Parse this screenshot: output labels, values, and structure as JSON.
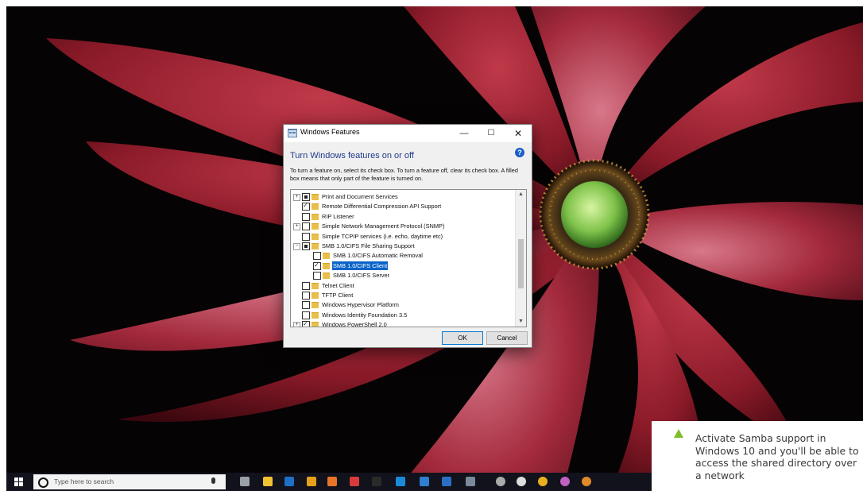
{
  "dialog": {
    "title": "Windows Features",
    "controls": {
      "minimize": "—",
      "maximize": "☐",
      "close": "✕"
    },
    "heading": "Turn Windows features on or off",
    "help_icon": "?",
    "instructions": "To turn a feature on, select its check box. To turn a feature off, clear its check box. A filled box means that only part of the feature is turned on.",
    "features": [
      {
        "label": "Print and Document Services",
        "state": "partial",
        "expandable": true,
        "indent": 0
      },
      {
        "label": "Remote Differential Compression API Support",
        "state": "checked",
        "expandable": false,
        "indent": 0
      },
      {
        "label": "RIP Listener",
        "state": "unchecked",
        "expandable": false,
        "indent": 0
      },
      {
        "label": "Simple Network Management Protocol (SNMP)",
        "state": "unchecked",
        "expandable": true,
        "indent": 0
      },
      {
        "label": "Simple TCPIP services (i.e. echo, daytime etc)",
        "state": "unchecked",
        "expandable": false,
        "indent": 0
      },
      {
        "label": "SMB 1.0/CIFS File Sharing Support",
        "state": "partial",
        "expandable": true,
        "expanded": true,
        "indent": 0
      },
      {
        "label": "SMB 1.0/CIFS Automatic Removal",
        "state": "unchecked",
        "expandable": false,
        "indent": 1
      },
      {
        "label": "SMB 1.0/CIFS Client",
        "state": "checked",
        "expandable": false,
        "indent": 1,
        "selected": true
      },
      {
        "label": "SMB 1.0/CIFS Server",
        "state": "unchecked",
        "expandable": false,
        "indent": 1
      },
      {
        "label": "Telnet Client",
        "state": "unchecked",
        "expandable": false,
        "indent": 0
      },
      {
        "label": "TFTP Client",
        "state": "unchecked",
        "expandable": false,
        "indent": 0
      },
      {
        "label": "Windows Hypervisor Platform",
        "state": "unchecked",
        "expandable": false,
        "indent": 0
      },
      {
        "label": "Windows Identity Foundation 3.5",
        "state": "unchecked",
        "expandable": false,
        "indent": 0
      },
      {
        "label": "Windows PowerShell 2.0",
        "state": "checked",
        "expandable": true,
        "indent": 0
      }
    ],
    "ok_label": "OK",
    "cancel_label": "Cancel"
  },
  "taskbar": {
    "search_placeholder": "Type here to search",
    "pinned_apps": [
      {
        "icon": "task-view-icon",
        "color": "#9aa0a8"
      },
      {
        "icon": "file-explorer-icon",
        "color": "#f1c232"
      },
      {
        "icon": "outlook-icon",
        "color": "#1f6fc5"
      },
      {
        "icon": "chrome-icon",
        "color": "#e5a11a"
      },
      {
        "icon": "firefox-icon",
        "color": "#e8732a"
      },
      {
        "icon": "app-red-icon",
        "color": "#d83b3b"
      },
      {
        "icon": "terminal-icon",
        "color": "#2a2a2a"
      },
      {
        "icon": "skype-icon",
        "color": "#1a8ad6"
      },
      {
        "icon": "info-icon",
        "color": "#2f7fd0"
      },
      {
        "icon": "mail-icon",
        "color": "#2b6fc4"
      },
      {
        "icon": "windows-features-icon",
        "color": "#7a8a9a"
      },
      {
        "icon": "gear-app-icon",
        "color": "#aaaaaa"
      },
      {
        "icon": "github-icon",
        "color": "#dddddd"
      },
      {
        "icon": "star-app-icon",
        "color": "#e8b020"
      },
      {
        "icon": "app-multicolor-icon",
        "color": "#c060c0"
      },
      {
        "icon": "app-orange-icon",
        "color": "#e08a2a"
      }
    ]
  },
  "caption": {
    "text": "Activate Samba support in Windows 10 and you'll be able to access the shared directory over a network",
    "accent_color": "#7fbe2b"
  }
}
